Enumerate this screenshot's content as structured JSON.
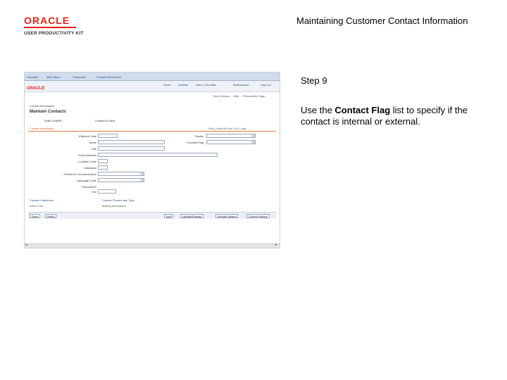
{
  "header": {
    "logo_word": "ORACLE",
    "logo_sub": "USER PRODUCTIVITY KIT",
    "doc_title": "Maintaining Customer Contact Information",
    "brand_color": "#e2231a"
  },
  "step": {
    "label": "Step 9",
    "instruction_pre": "Use the ",
    "instruction_bold": "Contact Flag",
    "instruction_post": " list to specify if the contact is internal or external."
  },
  "screenshot": {
    "breadcrumbs": [
      "Favorites",
      "Main Menu",
      "Customers",
      "Contact Information"
    ],
    "mini_logo": "ORACLE",
    "nav_links": [
      "Home",
      "Worklist",
      "Add to Favorites",
      "Multichannel",
      "Sign out"
    ],
    "util_links": [
      "New Window",
      "Help",
      "Personalize Page"
    ],
    "page_title": "Contact Information",
    "page_heading": "Maintain Contacts",
    "ids": [
      "SetID  SHARE",
      "Contact ID  Next"
    ],
    "section_title": "Contact Information",
    "section_nav": "Find | View All    First  1 of 1  Last",
    "fields": [
      {
        "label": "Effective Date"
      },
      {
        "label": "Name"
      },
      {
        "label": "Title"
      },
      {
        "label": "Email Address"
      },
      {
        "label": "Location Code"
      },
      {
        "label": "Salutation"
      },
      {
        "label": "*Preferred Communication"
      },
      {
        "label": "Language Code"
      },
      {
        "label": "Personal ID"
      },
      {
        "label": "Fax"
      }
    ],
    "right_fields": [
      {
        "label": "*Status"
      },
      {
        "label": "*Contact Flag"
      }
    ],
    "links_row1": [
      "Contact Customers",
      "Contact Phones and Type"
    ],
    "links_row2": [
      "Add to List",
      "Mailing Information"
    ],
    "left_buttons": [
      "Save",
      "Notify"
    ],
    "buttons": [
      "Add",
      "Update/Display",
      "Include History",
      "Correct History"
    ]
  }
}
